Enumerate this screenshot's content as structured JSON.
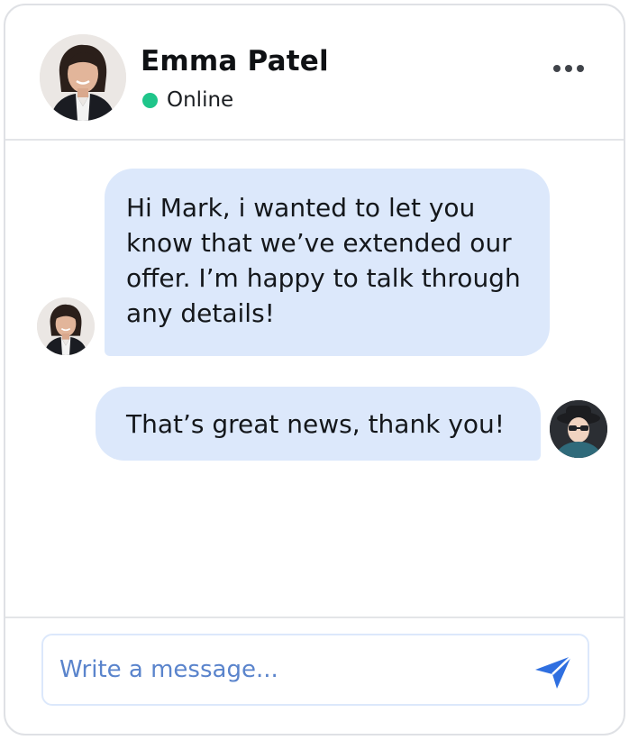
{
  "header": {
    "contact_name": "Emma Patel",
    "status": "Online",
    "status_color": "#1fc58a"
  },
  "messages": [
    {
      "direction": "incoming",
      "text": "Hi Mark, i wanted to let you know that we’ve extended our offer. I’m happy to talk through any details!"
    },
    {
      "direction": "outgoing",
      "text": "That’s great news, thank you!"
    }
  ],
  "composer": {
    "placeholder": "Write a message...",
    "send_icon": "send-icon"
  },
  "colors": {
    "bubble": "#dce8fb",
    "accent": "#2f6fe0",
    "online": "#1fc58a"
  }
}
